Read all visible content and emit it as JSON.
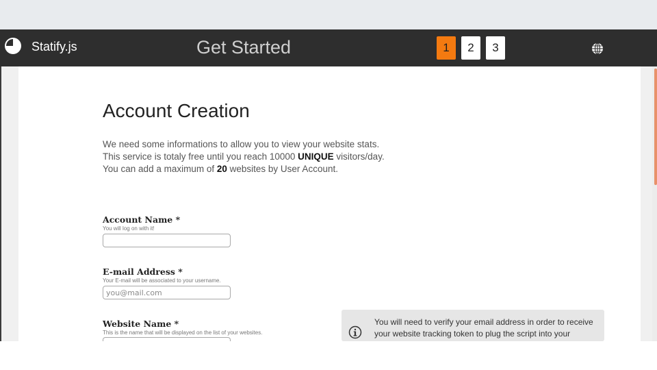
{
  "header": {
    "brand": "Statify.js",
    "title": "Get Started",
    "steps": [
      "1",
      "2",
      "3"
    ],
    "active_step": "1"
  },
  "main": {
    "heading": "Account Creation",
    "intro": {
      "line1": "We need some informations to allow you to view your website stats.",
      "line2_a": "This service is totaly free until you reach 10000 ",
      "line2_b": "UNIQUE",
      "line2_c": " visitors/day.",
      "line3_a": "You can add a maximum of ",
      "line3_b": "20",
      "line3_c": " websites by User Account."
    },
    "fields": {
      "account_name": {
        "label": "Account Name *",
        "hint": "You will log on with it!",
        "value": "",
        "placeholder": ""
      },
      "email": {
        "label": "E-mail Address *",
        "hint": "Your E-mail will be associated to your username.",
        "value": "",
        "placeholder": "you@mail.com"
      },
      "website_name": {
        "label": "Website Name *",
        "hint": "This is the name that will be displayed on the list of your websites.",
        "value": "",
        "placeholder": ""
      }
    },
    "info": {
      "text": "You will need to verify your email address in order to receive your website tracking token to plug the script into your website."
    }
  },
  "icons": {
    "logo": "pie-chart-icon",
    "language": "globe-icon",
    "info": "info-circle-icon"
  },
  "colors": {
    "navbar": "#2e2e2e",
    "accent": "#f47a10",
    "info_box": "#e6e6e6"
  }
}
